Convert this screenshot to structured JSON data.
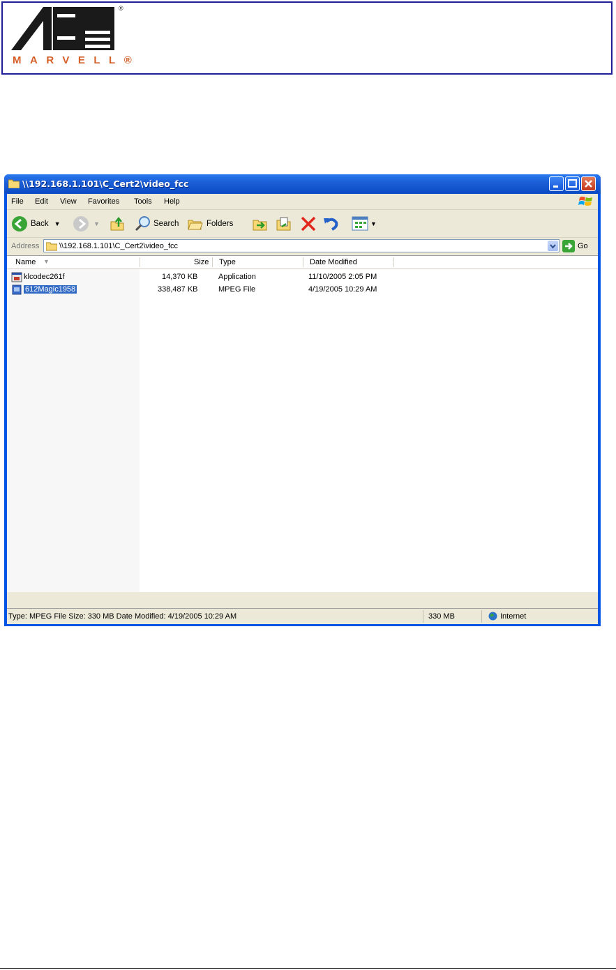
{
  "header": {
    "logo_text": "MARVELL®",
    "logo_mark_reg": "®"
  },
  "window": {
    "title": "\\\\192.168.1.101\\C_Cert2\\video_fcc",
    "menu": [
      "File",
      "Edit",
      "View",
      "Favorites",
      "Tools",
      "Help"
    ],
    "toolbar": {
      "back": "Back",
      "search": "Search",
      "folders": "Folders"
    },
    "address": {
      "label": "Address",
      "value": "\\\\192.168.1.101\\C_Cert2\\video_fcc",
      "go": "Go"
    },
    "columns": [
      "Name",
      "Size",
      "Type",
      "Date Modified"
    ],
    "files": [
      {
        "name": "klcodec261f",
        "size": "14,370 KB",
        "type": "Application",
        "date": "11/10/2005 2:05 PM"
      },
      {
        "name": "612Magic1958",
        "size": "338,487 KB",
        "type": "MPEG File",
        "date": "4/19/2005 10:29 AM"
      }
    ],
    "status": {
      "info": "Type: MPEG File Size: 330 MB Date Modified: 4/19/2005 10:29 AM",
      "size": "330 MB",
      "zone": "Internet"
    }
  },
  "colors": {
    "titlebar": "#0054e3",
    "selection": "#316ac5",
    "brand": "#d5602a"
  },
  "icons": [
    "marvell-logo",
    "folder-icon",
    "minimize-icon",
    "maximize-icon",
    "close-icon",
    "windows-flag-icon",
    "back-icon",
    "forward-icon",
    "up-folder-icon",
    "search-icon",
    "folders-icon",
    "move-to-icon",
    "copy-to-icon",
    "delete-icon",
    "undo-icon",
    "views-icon",
    "go-icon",
    "application-icon",
    "mpeg-file-icon",
    "internet-icon"
  ]
}
